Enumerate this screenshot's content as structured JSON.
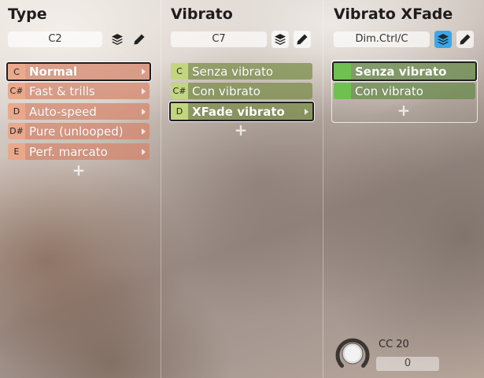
{
  "columns": [
    {
      "title": "Type",
      "key_value": "C2",
      "articulations": [
        {
          "key": "C",
          "label": "Normal"
        },
        {
          "key": "C#",
          "label": "Fast & trills"
        },
        {
          "key": "D",
          "label": "Auto-speed"
        },
        {
          "key": "D#",
          "label": "Pure (unlooped)"
        },
        {
          "key": "E",
          "label": "Perf. marcato"
        }
      ],
      "selected_index": 0,
      "add_symbol": "+"
    },
    {
      "title": "Vibrato",
      "key_value": "C7",
      "articulations": [
        {
          "key": "C",
          "label": "Senza vibrato"
        },
        {
          "key": "C#",
          "label": "Con vibrato"
        },
        {
          "key": "D",
          "label": "XFade vibrato"
        }
      ],
      "selected_index": 2,
      "add_symbol": "+"
    },
    {
      "title": "Vibrato XFade",
      "key_value": "Dim.Ctrl/C",
      "articulations": [
        {
          "key": "",
          "label": "Senza vibrato"
        },
        {
          "key": "",
          "label": "Con vibrato"
        }
      ],
      "selected_index": 0,
      "add_symbol": "+",
      "layers_active": true
    }
  ],
  "controller": {
    "label": "CC 20",
    "value": "0"
  },
  "icons": {
    "layers": "layers-icon",
    "edit": "pencil-icon",
    "knob": "knob-icon"
  },
  "colors": {
    "type_accent": "#d68469",
    "vibrato_accent": "#c8dc82",
    "xfade_accent": "#6fc050",
    "active_button": "#3aa6e8"
  }
}
